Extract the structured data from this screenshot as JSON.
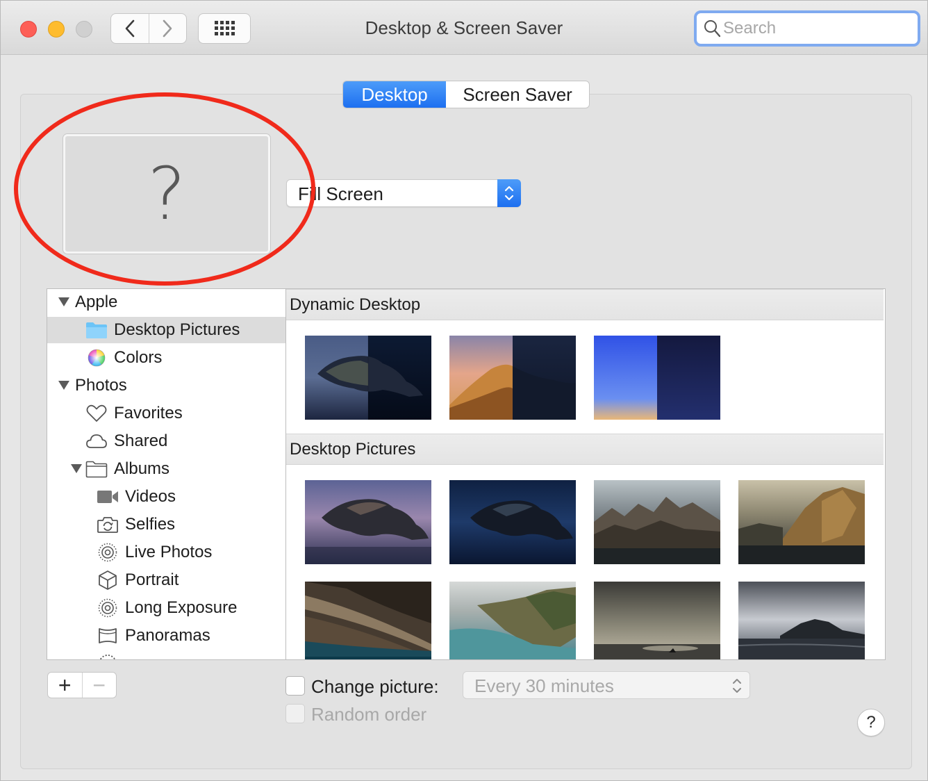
{
  "window": {
    "title": "Desktop & Screen Saver",
    "search_placeholder": "Search"
  },
  "tabs": [
    {
      "label": "Desktop",
      "selected": true
    },
    {
      "label": "Screen Saver",
      "selected": false
    }
  ],
  "fit_select": {
    "value": "Fill Screen"
  },
  "preview": {
    "symbol": "?"
  },
  "sidebar": {
    "apple": "Apple",
    "desktop_pictures": "Desktop Pictures",
    "colors": "Colors",
    "photos": "Photos",
    "favorites": "Favorites",
    "shared": "Shared",
    "albums": "Albums",
    "videos": "Videos",
    "selfies": "Selfies",
    "live_photos": "Live Photos",
    "portrait": "Portrait",
    "long_exposure": "Long Exposure",
    "panoramas": "Panoramas"
  },
  "gallery": {
    "dynamic_header": "Dynamic Desktop",
    "pictures_header": "Desktop Pictures"
  },
  "bottom": {
    "plus": "+",
    "minus": "−",
    "change_picture": "Change picture:",
    "interval": "Every 30 minutes",
    "random_order": "Random order",
    "help": "?"
  },
  "colors": {
    "accent": "#1d6ff0",
    "annotation": "#f02a1b"
  }
}
